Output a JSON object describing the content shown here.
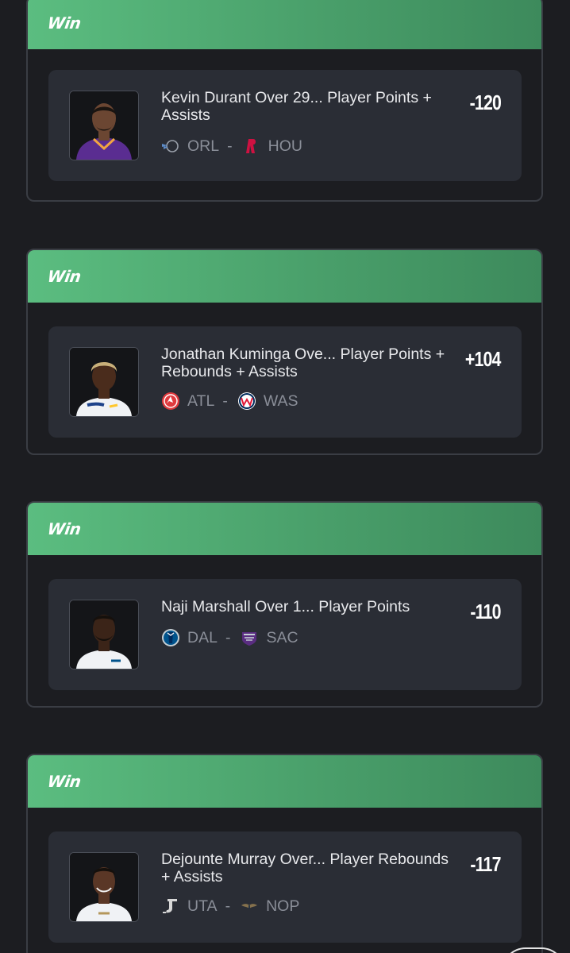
{
  "cards": [
    {
      "badge": "Win",
      "title": "Kevin Durant Over 29... Player Points + Assists",
      "odds": "-120",
      "away": {
        "abbr": "ORL",
        "icon": "orl-logo-icon"
      },
      "home": {
        "abbr": "HOU",
        "icon": "hou-logo-icon"
      }
    },
    {
      "badge": "Win",
      "title": "Jonathan Kuminga Ove... Player Points + Rebounds + Assists",
      "odds": "+104",
      "away": {
        "abbr": "ATL",
        "icon": "atl-logo-icon"
      },
      "home": {
        "abbr": "WAS",
        "icon": "was-logo-icon"
      }
    },
    {
      "badge": "Win",
      "title": "Naji Marshall Over 1... Player Points",
      "odds": "-110",
      "away": {
        "abbr": "DAL",
        "icon": "dal-logo-icon"
      },
      "home": {
        "abbr": "SAC",
        "icon": "sac-logo-icon"
      }
    },
    {
      "badge": "Win",
      "title": "Dejounte Murray Over... Player Rebounds + Assists",
      "odds": "-117",
      "away": {
        "abbr": "UTA",
        "icon": "uta-logo-icon"
      },
      "home": {
        "abbr": "NOP",
        "icon": "nop-logo-icon"
      }
    }
  ],
  "separator": "-",
  "colors": {
    "background": "#1c1d21",
    "header_green": "#4aa06b",
    "bet_panel": "#2a2d35",
    "muted_text": "#8a8e98"
  }
}
